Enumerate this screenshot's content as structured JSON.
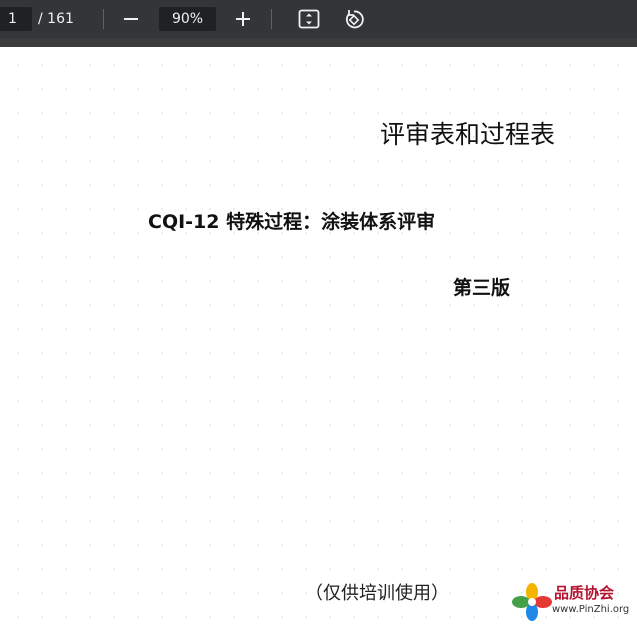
{
  "toolbar": {
    "current_page": "1",
    "total_pages": "/ 161",
    "zoom": "90%",
    "icons": [
      "minus-icon",
      "plus-icon",
      "fit-page-icon",
      "rotate-icon"
    ]
  },
  "document": {
    "title": "评审表和过程表",
    "subtitle": "CQI-12 特殊过程：涂装体系评审",
    "edition": "第三版",
    "note": "（仅供培训使用）"
  },
  "watermark": {
    "name": "品质协会",
    "url": "www.PinZhi.org"
  },
  "colors": {
    "toolbar_bg": "#323639",
    "input_bg": "#1f2124",
    "watermark_red": "#b5122f"
  }
}
